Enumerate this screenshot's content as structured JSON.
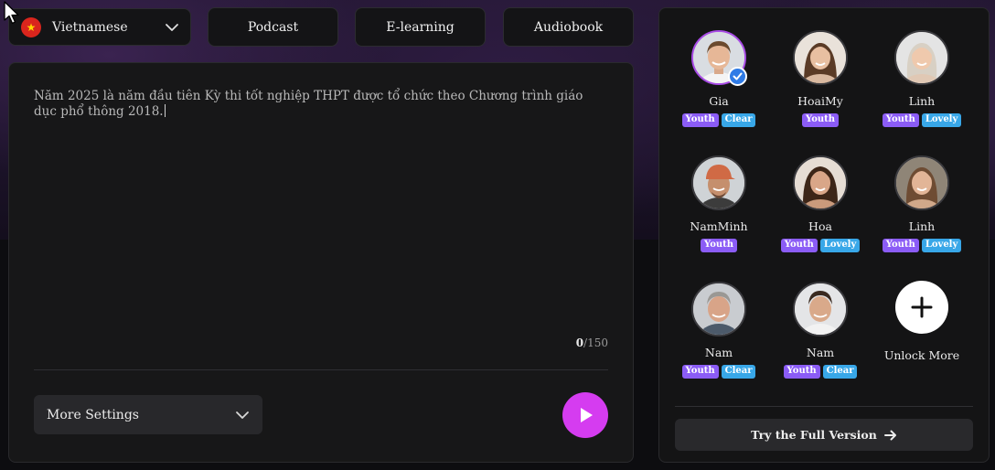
{
  "language": {
    "label": "Vietnamese",
    "flag_icon": "vietnam-flag-icon"
  },
  "modes": [
    {
      "label": "Podcast"
    },
    {
      "label": "E-learning"
    },
    {
      "label": "Audiobook"
    }
  ],
  "editor": {
    "text": "Năm 2025 là năm đầu tiên Kỳ thi tốt nghiệp THPT được tổ chức theo Chương trình giáo dục phổ thông 2018.",
    "count_current": "0",
    "count_max": "/150"
  },
  "settings": {
    "label": "More Settings"
  },
  "play": {
    "icon": "play-icon",
    "color": "#d53cf0"
  },
  "voices": [
    {
      "name": "Gia",
      "tags": [
        "Youth",
        "Clear"
      ],
      "selected": true
    },
    {
      "name": "HoaiMy",
      "tags": [
        "Youth"
      ]
    },
    {
      "name": "Linh",
      "tags": [
        "Youth",
        "Lovely"
      ]
    },
    {
      "name": "NamMinh",
      "tags": [
        "Youth"
      ]
    },
    {
      "name": "Hoa",
      "tags": [
        "Youth",
        "Lovely"
      ]
    },
    {
      "name": "Linh",
      "tags": [
        "Youth",
        "Lovely"
      ]
    },
    {
      "name": "Nam",
      "tags": [
        "Youth",
        "Clear"
      ]
    },
    {
      "name": "Nam",
      "tags": [
        "Youth",
        "Clear"
      ]
    }
  ],
  "unlock": {
    "label": "Unlock More",
    "icon": "plus-icon"
  },
  "cta": {
    "label": "Try the Full Version",
    "icon": "arrow-right-icon"
  },
  "colors": {
    "accent": "#d53cf0",
    "tag_youth": "#8b5cf6",
    "tag_clear": "#38a7e8",
    "verified": "#2f7be6"
  }
}
